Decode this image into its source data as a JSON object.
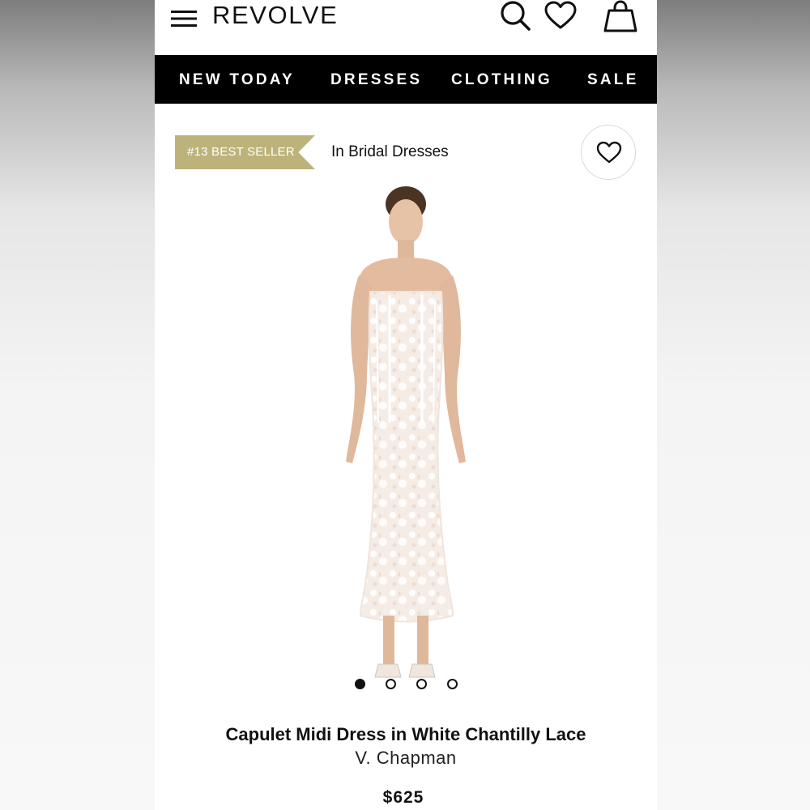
{
  "header": {
    "logo": "REVOLVE",
    "icons": [
      "menu-icon",
      "search-icon",
      "heart-icon",
      "shopping-bag-icon"
    ]
  },
  "nav": {
    "items": [
      {
        "label": "NEW TODAY"
      },
      {
        "label": "DRESSES"
      },
      {
        "label": "CLOTHING"
      },
      {
        "label": "SALE"
      }
    ]
  },
  "badge": {
    "text": "#13 BEST SELLER",
    "color": "#bdb37a"
  },
  "category": {
    "text": "In Bridal Dresses"
  },
  "carousel": {
    "total": 4,
    "active_index": 0
  },
  "product": {
    "name": "Capulet Midi Dress in White Chantilly Lace",
    "brand": "V. Chapman",
    "price": "$625"
  }
}
